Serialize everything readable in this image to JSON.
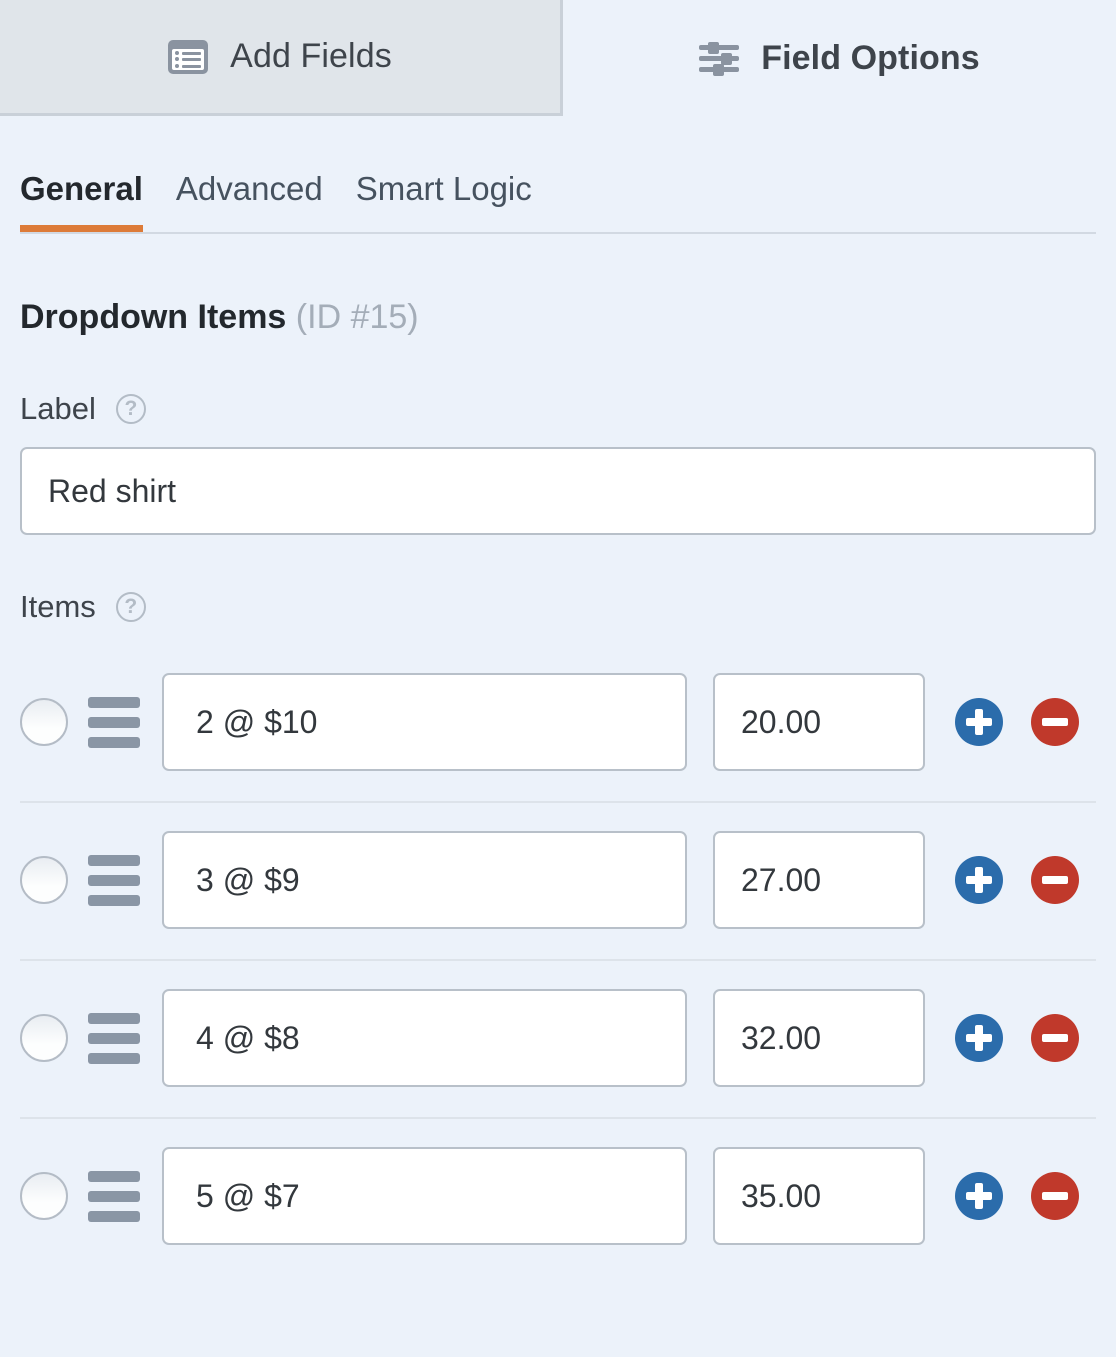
{
  "top_tabs": [
    {
      "label": "Add Fields",
      "icon": "list-icon",
      "active": false
    },
    {
      "label": "Field Options",
      "icon": "sliders-icon",
      "active": true
    }
  ],
  "sub_tabs": [
    {
      "label": "General",
      "active": true
    },
    {
      "label": "Advanced",
      "active": false
    },
    {
      "label": "Smart Logic",
      "active": false
    }
  ],
  "section": {
    "title": "Dropdown Items",
    "id": "(ID #15)"
  },
  "label_field": {
    "label": "Label",
    "help_icon": "question-mark-icon",
    "value": "Red shirt",
    "placeholder": ""
  },
  "items_field": {
    "label": "Items",
    "help_icon": "question-mark-icon",
    "rows": [
      {
        "choice": "2 @ $10",
        "price": "20.00",
        "selected": false
      },
      {
        "choice": "3 @ $9",
        "price": "27.00",
        "selected": false
      },
      {
        "choice": "4 @ $8",
        "price": "32.00",
        "selected": false
      },
      {
        "choice": "5 @ $7",
        "price": "35.00",
        "selected": false
      }
    ],
    "add_icon": "plus-icon",
    "remove_icon": "minus-icon",
    "drag_icon": "drag-handle-icon",
    "radio_icon": "radio-button-icon"
  },
  "colors": {
    "accent_orange": "#dd7b38",
    "add_blue": "#2b6cab",
    "remove_red": "#c0392b",
    "panel_bg": "#ecf2fa",
    "inactive_tab_bg": "#e0e5ea"
  }
}
